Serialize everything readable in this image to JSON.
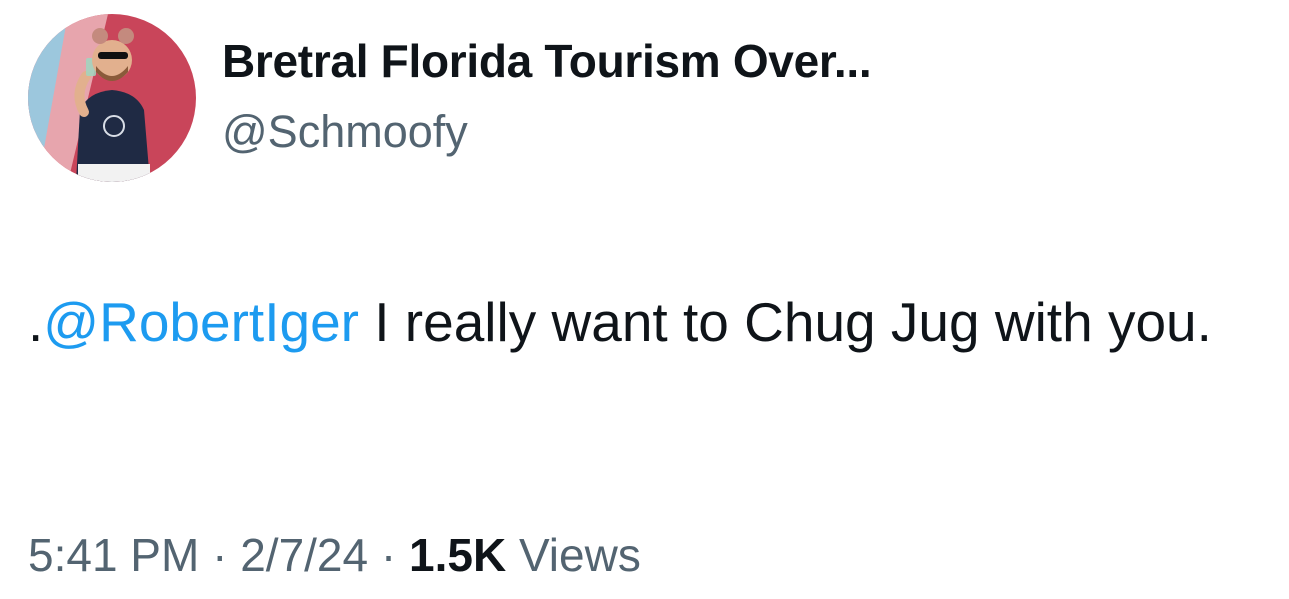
{
  "user": {
    "display_name": "Bretral Florida Tourism Over...",
    "handle": "@Schmoofy",
    "avatar_icon": "profile-photo"
  },
  "tweet": {
    "prefix": ".",
    "mention": "@RobertIger",
    "text": " I really want to Chug Jug with you."
  },
  "meta": {
    "time": "5:41 PM",
    "separator": "·",
    "date": "2/7/24",
    "views_count": "1.5K",
    "views_label": "Views"
  },
  "colors": {
    "text": "#0f1419",
    "secondary": "#536471",
    "link": "#1d9bf0"
  }
}
